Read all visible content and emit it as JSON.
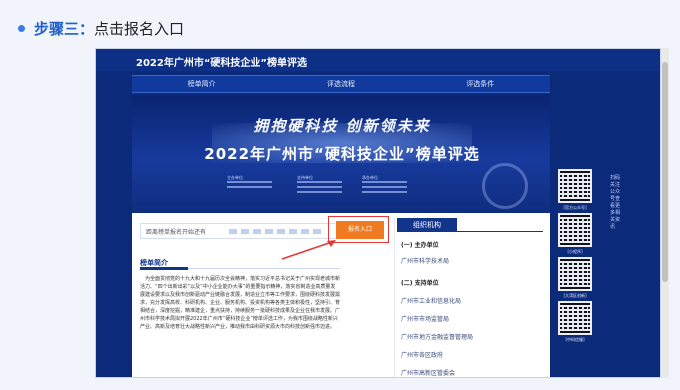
{
  "step": {
    "label": "步骤三：",
    "text": "点击报名入口"
  },
  "site": {
    "title": "2022年广州市“硬科技企业”榜单评选",
    "nav": [
      "榜单简介",
      "评选流程",
      "评选条件"
    ]
  },
  "banner": {
    "slogan": "拥抱硬科技 创新领未来",
    "title": "2022年广州市“硬科技企业”榜单评选",
    "org_labels": [
      "主办单位",
      "支持单位",
      "承办单位"
    ]
  },
  "countdown": {
    "label": "距离榜单报名开始还有"
  },
  "register_button": "报名入口",
  "intro": {
    "title": "榜单简介",
    "body": "为全面贯彻党的十九大和十九届历次全会精神，落实习近平总书记关于广州实现老城市新活力、“四个出新出彩”以及“中小企业能办大事”的重要指示精神，落实省制造业高质量发展建设要求以及我市创新驱动产业链融合发展，制造业立市等工作要求，围绕硬科技发展需求，充分发挥高校、科研机构、企业、服务机构、投资机构等各类主体积极性，坚持引、育相结合，深度挖掘，精准建企，重点扶持，持续服务一批硬科技成果及企业在我市发展。广州市科学技术局拟开展2022年广州市“硬科技企业”榜单评选工作，为我市围绕战略性新兴产业、高新及培育壮大战略性新兴产业，推动我市由科研资源大市向科技创新强市迈进。"
  },
  "org": {
    "heading": "组织机构",
    "host_label": "(一) 主办单位",
    "host": "广州市科学技术局",
    "support_label": "(二) 支持单位",
    "supporters": [
      "广州市工业和信息化局",
      "广州市市场监管局",
      "广州市地方金融监督管理局",
      "广州市各区政府",
      "广州市高新区管委会"
    ]
  },
  "qr": {
    "captions": [
      "[官方公众号]",
      "[小程序]",
      "[大湾区创新]",
      "[中科信服]"
    ],
    "side_text": "扫码关注公众号查看更多相关资讯"
  }
}
